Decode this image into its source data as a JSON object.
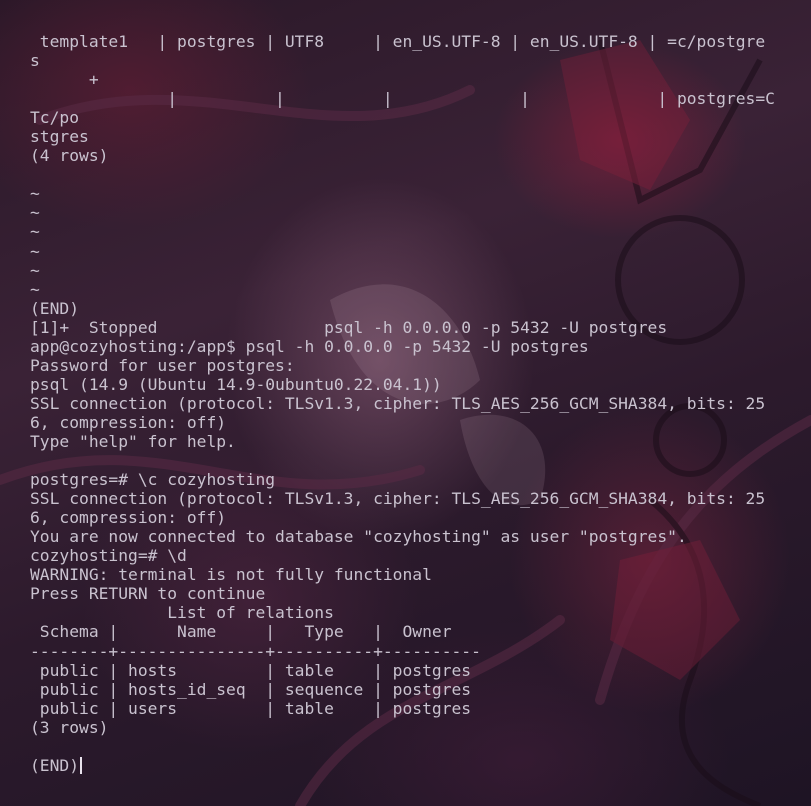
{
  "terminal": {
    "lines": [
      " template1   | postgres | UTF8     | en_US.UTF-8 | en_US.UTF-8 | =c/postgre",
      "s",
      "      +",
      "              |          |          |             |             | postgres=C",
      "Tc/po",
      "stgres",
      "(4 rows)",
      "",
      "~",
      "~",
      "~",
      "~",
      "~",
      "~",
      "(END)",
      "[1]+  Stopped                 psql -h 0.0.0.0 -p 5432 -U postgres",
      "app@cozyhosting:/app$ psql -h 0.0.0.0 -p 5432 -U postgres",
      "Password for user postgres: ",
      "psql (14.9 (Ubuntu 14.9-0ubuntu0.22.04.1))",
      "SSL connection (protocol: TLSv1.3, cipher: TLS_AES_256_GCM_SHA384, bits: 25",
      "6, compression: off)",
      "Type \"help\" for help.",
      "",
      "postgres=# \\c cozyhosting",
      "SSL connection (protocol: TLSv1.3, cipher: TLS_AES_256_GCM_SHA384, bits: 25",
      "6, compression: off)",
      "You are now connected to database \"cozyhosting\" as user \"postgres\".",
      "cozyhosting=# \\d",
      "WARNING: terminal is not fully functional",
      "Press RETURN to continue ",
      "              List of relations",
      " Schema |      Name     |   Type   |  Owner",
      "--------+---------------+----------+----------",
      " public | hosts         | table    | postgres",
      " public | hosts_id_seq  | sequence | postgres",
      " public | users         | table    | postgres",
      "(3 rows)",
      "",
      "(END)"
    ]
  },
  "colors": {
    "text": "#c9c2cf",
    "cursor": "#e8e2ec",
    "background": "#2a1828"
  }
}
